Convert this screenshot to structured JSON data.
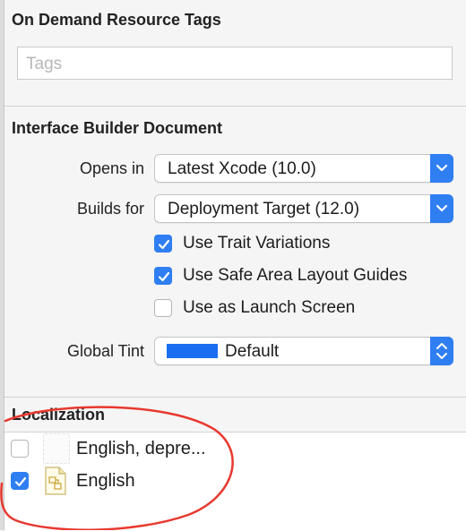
{
  "on_demand": {
    "title": "On Demand Resource Tags",
    "tags_placeholder": "Tags"
  },
  "ib_document": {
    "title": "Interface Builder Document",
    "opens_in_label": "Opens in",
    "opens_in_value": "Latest Xcode (10.0)",
    "builds_for_label": "Builds for",
    "builds_for_value": "Deployment Target (12.0)",
    "options": [
      {
        "label": "Use Trait Variations",
        "checked": true
      },
      {
        "label": "Use Safe Area Layout Guides",
        "checked": true
      },
      {
        "label": "Use as Launch Screen",
        "checked": false
      }
    ],
    "global_tint_label": "Global Tint",
    "global_tint_value": "Default",
    "tint_color": "#1a6ef0"
  },
  "localization": {
    "title": "Localization",
    "items": [
      {
        "label": "English, depre...",
        "checked": false,
        "icon": "file-placeholder-icon"
      },
      {
        "label": "English",
        "checked": true,
        "icon": "storyboard-file-icon"
      }
    ]
  },
  "colors": {
    "accent": "#2f7ef2",
    "annotation": "#e8382f"
  }
}
